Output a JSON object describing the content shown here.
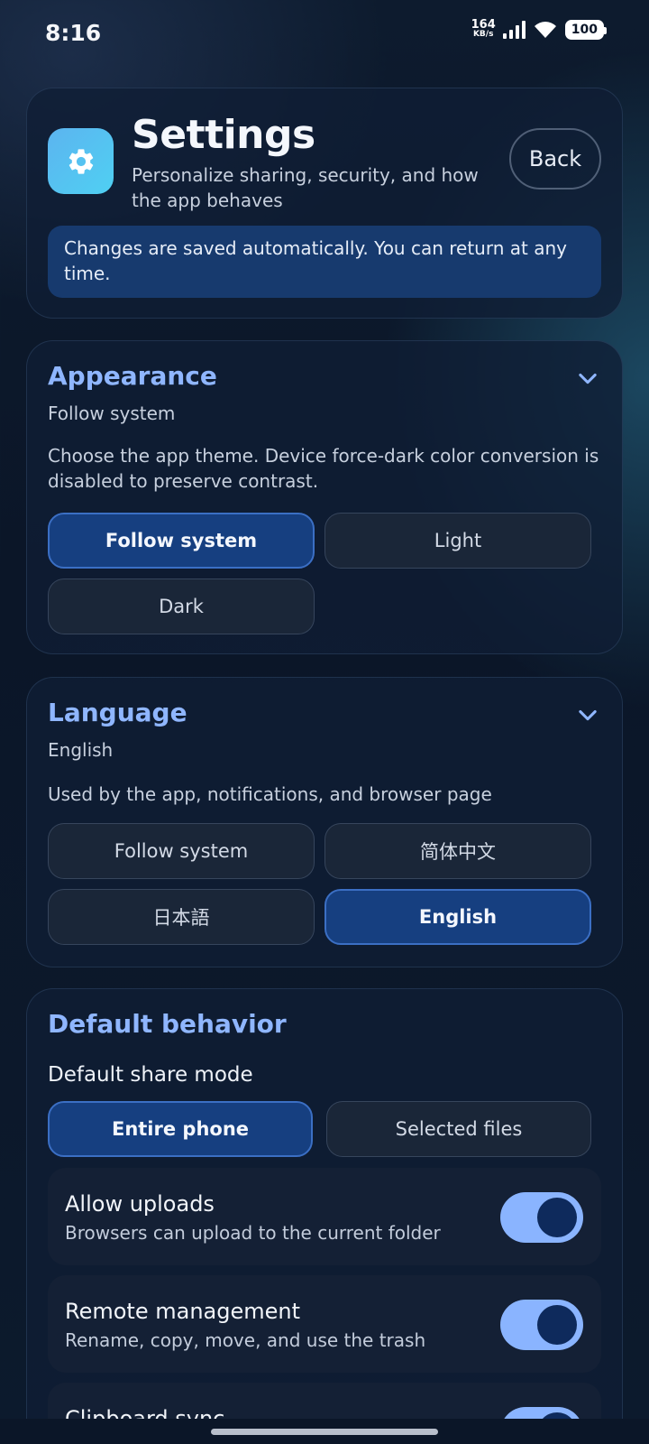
{
  "status_bar": {
    "time": "8:16",
    "net_speed_value": "164",
    "net_speed_unit": "KB/s",
    "battery": "100"
  },
  "header": {
    "title": "Settings",
    "subtitle": "Personalize sharing, security, and how the app behaves",
    "back_label": "Back",
    "info": "Changes are saved automatically. You can return at any time.",
    "icon": "gear-icon"
  },
  "appearance": {
    "title": "Appearance",
    "current": "Follow system",
    "description": "Choose the app theme. Device force-dark color conversion is disabled to preserve contrast.",
    "options": [
      "Follow system",
      "Light",
      "Dark"
    ],
    "selected": "Follow system"
  },
  "language": {
    "title": "Language",
    "current": "English",
    "description": "Used by the app, notifications, and browser page",
    "options": [
      "Follow system",
      "简体中文",
      "日本語",
      "English"
    ],
    "selected": "English"
  },
  "behavior": {
    "title": "Default behavior",
    "share_mode_label": "Default share mode",
    "share_modes": [
      "Entire phone",
      "Selected files"
    ],
    "selected_share_mode": "Entire phone",
    "toggles": [
      {
        "title": "Allow uploads",
        "description": "Browsers can upload to the current folder",
        "on": true
      },
      {
        "title": "Remote management",
        "description": "Rename, copy, move, and use the trash",
        "on": true
      },
      {
        "title": "Clipboard sync",
        "description": "",
        "on": true
      }
    ]
  },
  "colors": {
    "accent": "#8fb6ff",
    "selected_bg": "#163f80",
    "toggle_on": "#8ab4ff",
    "banner_bg": "#173a6e"
  }
}
